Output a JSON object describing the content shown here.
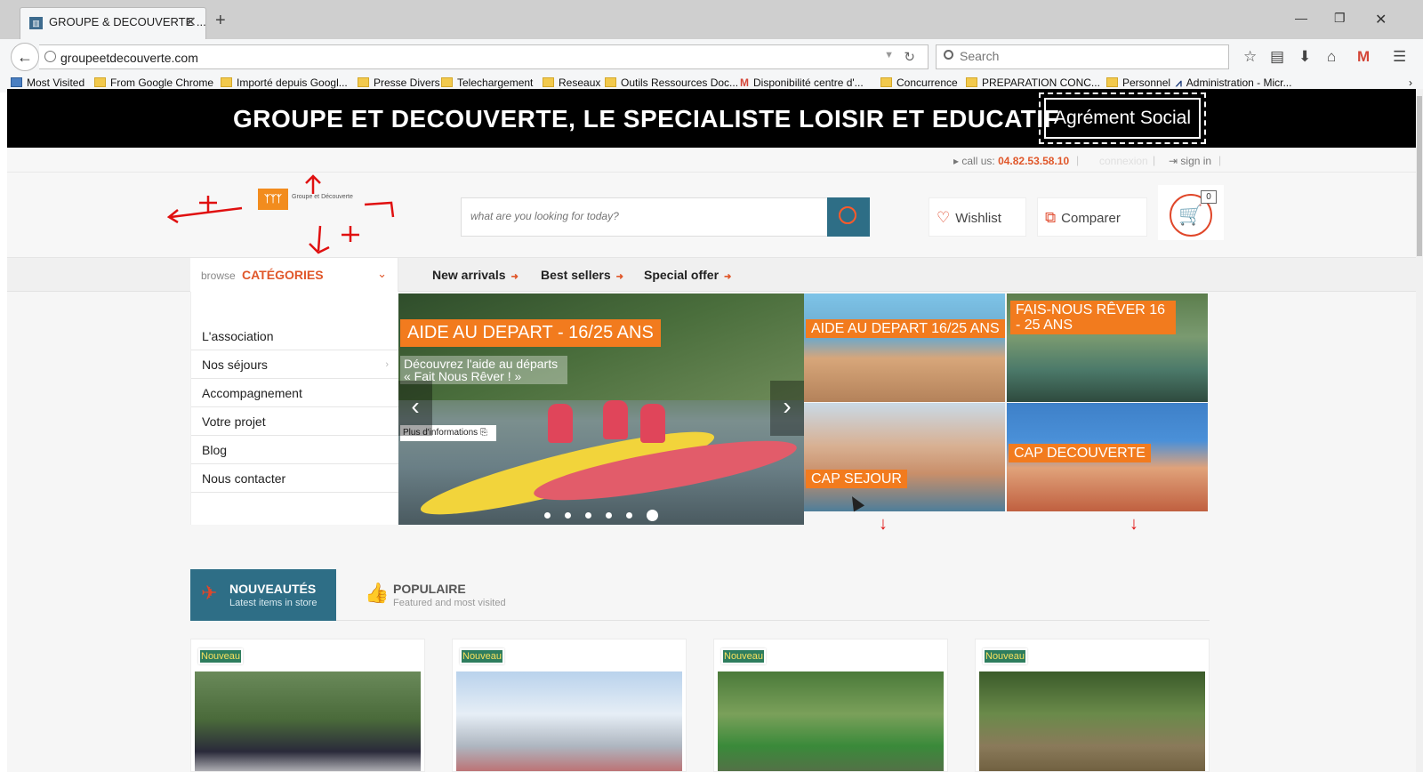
{
  "browser": {
    "tab_title": "GROUPE & DECOUVERTE ...",
    "url": "groupeetdecouverte.com",
    "search_placeholder": "Search",
    "bookmarks": [
      "Most Visited",
      "From Google Chrome",
      "Importé depuis Googl...",
      "Presse Divers",
      "Telechargement",
      "Reseaux",
      "Outils Ressources Doc...",
      "Disponibilité centre d'...",
      "Concurrence",
      "PREPARATION CONC...",
      "Personnel",
      "Administration - Micr..."
    ]
  },
  "banner": {
    "title": "GROUPE ET DECOUVERTE, LE SPECIALISTE LOISIR ET EDUCATIF",
    "badge": "Agrément Social"
  },
  "topbar": {
    "call_label": "call us:",
    "phone": "04.82.53.58.10",
    "ghost_link": "connexion",
    "signin": "sign in"
  },
  "header": {
    "logo_name": "Groupe et Découverte",
    "search_placeholder": "what are you looking for today?",
    "wishlist": "Wishlist",
    "compare": "Comparer",
    "cart_count": "0"
  },
  "catbar": {
    "browse_small": "browse",
    "browse_big": "CATÉGORIES",
    "links": [
      "New arrivals",
      "Best sellers",
      "Special offer"
    ]
  },
  "sidemenu": {
    "items": [
      "L'association",
      "Nos séjours",
      "Accompagnement",
      "Votre projet",
      "Blog",
      "Nous contacter"
    ]
  },
  "slider": {
    "title": "AIDE AU DEPART - 16/25 ANS",
    "desc": "Découvrez l'aide au départs « Fait Nous Rêver ! »",
    "more": "Plus d'informations"
  },
  "tiles": {
    "t1": "AIDE AU DEPART 16/25 ANS",
    "t2": "FAIS-NOUS RÊVER 16 - 25 ANS",
    "t3": "CAP SEJOUR",
    "t4": "CAP DECOUVERTE"
  },
  "tabs": {
    "new_title": "NOUVEAUTÉS",
    "new_sub": "Latest items in store",
    "pop_title": "POPULAIRE",
    "pop_sub": "Featured and most visited"
  },
  "products": {
    "badge": "Nouveau"
  },
  "colors": {
    "accent": "#e0572a",
    "teal": "#2e6e86",
    "orange_label": "#f27b1e"
  }
}
